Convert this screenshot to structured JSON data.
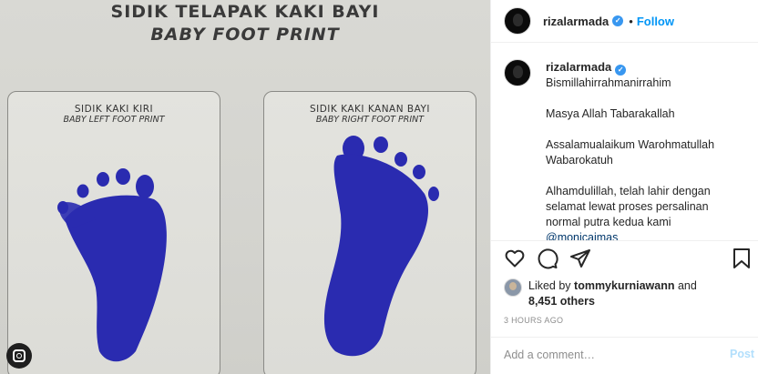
{
  "photo": {
    "title_line1": "SIDIK TELAPAK KAKI BAYI",
    "title_line2": "BABY FOOT PRINT",
    "left_card": {
      "heading": "SIDIK KAKI KIRI",
      "subheading": "BABY LEFT FOOT PRINT"
    },
    "right_card": {
      "heading": "SIDIK KAKI KANAN BAYI",
      "subheading": "BABY RIGHT FOOT PRINT"
    },
    "ink_color": "#2a2bb0"
  },
  "header": {
    "username": "rizalarmada",
    "separator": "•",
    "follow_label": "Follow",
    "verified_icon": "verified-badge-icon"
  },
  "caption": {
    "username": "rizalarmada",
    "lines": [
      "Bismillahirrahmanirrahim",
      "",
      "Masya Allah Tabarakallah",
      "",
      "Assalamualaikum Warohmatullah",
      "Wabarokatuh",
      "",
      "Alhamdulillah, telah lahir dengan",
      "selamat lewat proses persalinan",
      "normal putra kedua kami"
    ],
    "mention": "@monicaimas"
  },
  "actions": {
    "icons": [
      "heart-icon",
      "comment-icon",
      "share-icon",
      "bookmark-icon"
    ]
  },
  "likes": {
    "prefix": "Liked by ",
    "user": "tommykurniawann",
    "conjunction": " and",
    "others": "8,451 others"
  },
  "timestamp": "3 HOURS AGO",
  "comment": {
    "placeholder": "Add a comment…",
    "post_label": "Post"
  },
  "colors": {
    "accent": "#0095f6",
    "verified": "#3897f0",
    "post_disabled": "#b2dffc"
  }
}
